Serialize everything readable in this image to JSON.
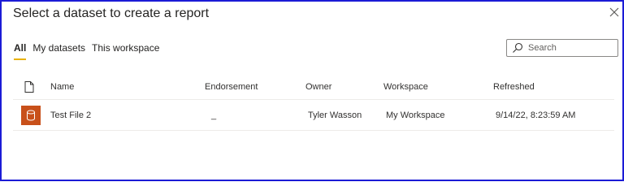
{
  "dialog": {
    "title": "Select a dataset to create a report",
    "close_icon": "close-icon"
  },
  "tabs": [
    {
      "label": "All",
      "active": true
    },
    {
      "label": "My datasets",
      "active": false
    },
    {
      "label": "This workspace",
      "active": false
    }
  ],
  "search": {
    "placeholder": "Search",
    "icon": "search-icon"
  },
  "table": {
    "columns": {
      "type_icon": "file-icon",
      "name": "Name",
      "endorsement": "Endorsement",
      "owner": "Owner",
      "workspace": "Workspace",
      "refreshed": "Refreshed"
    },
    "rows": [
      {
        "icon": "dataset-icon",
        "icon_color": "#c8501a",
        "name": "Test File 2",
        "endorsement": "_",
        "owner": "Tyler Wasson",
        "workspace": "My Workspace",
        "refreshed": "9/14/22, 8:23:59 AM"
      }
    ]
  },
  "colors": {
    "frame_border": "#1b1bd6",
    "active_tab_underline": "#e8b100"
  }
}
